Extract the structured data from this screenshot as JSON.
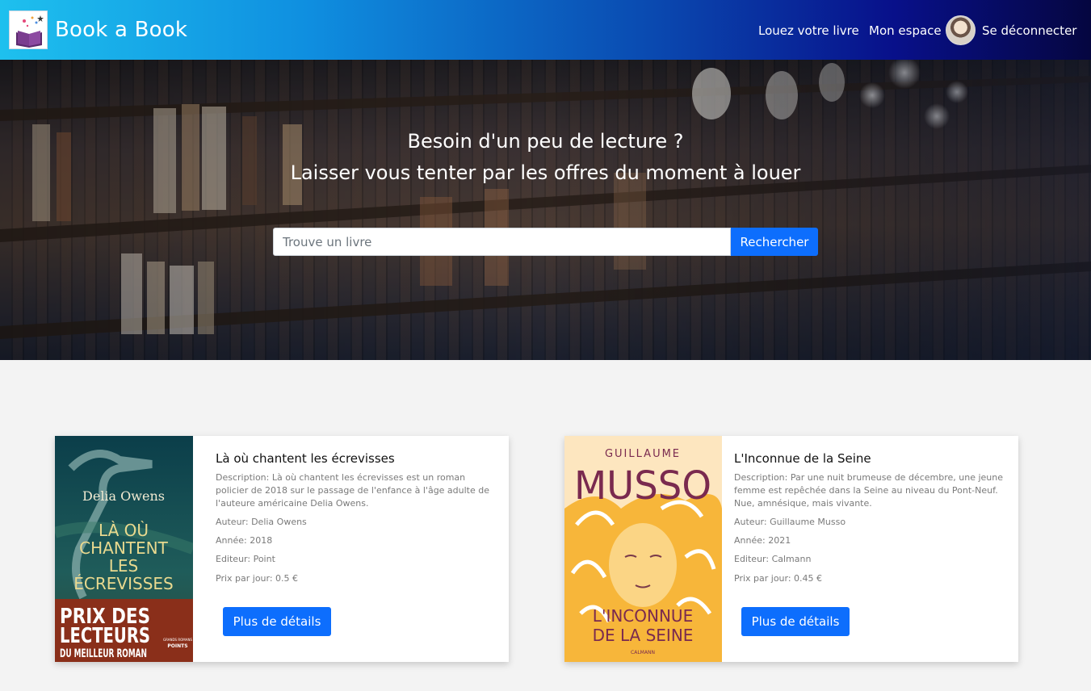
{
  "header": {
    "brand": "Book a Book",
    "nav": {
      "rent": "Louez votre livre",
      "space": "Mon espace",
      "logout": "Se déconnecter"
    }
  },
  "hero": {
    "line1": "Besoin d'un peu de lecture ?",
    "line2": "Laisser vous tenter par les offres du moment à louer",
    "search_placeholder": "Trouve un livre",
    "search_button": "Rechercher"
  },
  "books": [
    {
      "title": "Là où chantent les écrevisses",
      "description": "Description: Là où chantent les écrevisses est un roman policier de 2018 sur le passage de l'enfance à l'âge adulte de l'auteure américaine Delia Owens.",
      "author": "Auteur: Delia Owens",
      "year": "Année: 2018",
      "publisher": "Editeur: Point",
      "price": "Prix par jour: 0.5 €",
      "button": "Plus de détails",
      "cover": {
        "author": "Delia Owens",
        "title_lines": [
          "LÀ OÙ",
          "CHANTENT",
          "LES",
          "ÉCREVISSES"
        ],
        "banner_lines": [
          "PRIX DES",
          "LECTEURS",
          "DU MEILLEUR ROMAN"
        ],
        "badge_small": "GRANDS ROMANS",
        "badge": "POINTS"
      }
    },
    {
      "title": "L'Inconnue de la Seine",
      "description": "Description: Par une nuit brumeuse de décembre, une jeune femme est repêchée dans la Seine au niveau du Pont-Neuf. Nue, amnésique, mais vivante.",
      "author": "Auteur: Guillaume Musso",
      "year": "Année: 2021",
      "publisher": "Editeur: Calmann",
      "price": "Prix par jour: 0.45 €",
      "button": "Plus de détails",
      "cover": {
        "author_first": "GUILLAUME",
        "author_last": "MUSSO",
        "title_lines": [
          "L'INCONNUE",
          "DE LA SEINE"
        ],
        "publisher": "CALMANN"
      }
    }
  ]
}
